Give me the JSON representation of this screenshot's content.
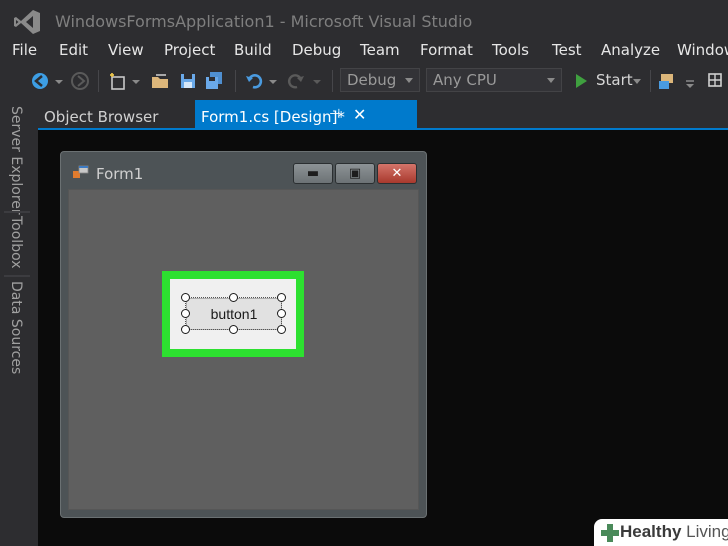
{
  "window": {
    "title": "WindowsFormsApplication1 - Microsoft Visual Studio"
  },
  "menu": [
    "File",
    "Edit",
    "View",
    "Project",
    "Build",
    "Debug",
    "Team",
    "Format",
    "Tools",
    "Test",
    "Analyze",
    "Window"
  ],
  "toolbar": {
    "config": "Debug",
    "platform": "Any CPU",
    "start_label": "Start"
  },
  "side_tabs": [
    "Server Explorer",
    "Toolbox",
    "Data Sources"
  ],
  "doc_tabs": [
    {
      "label": "Object Browser",
      "active": false
    },
    {
      "label": "Form1.cs [Design]*",
      "active": true
    }
  ],
  "tab_icons": {
    "pin": "⊣",
    "close": "✕"
  },
  "form": {
    "title": "Form1",
    "min_glyph": "▬",
    "max_glyph": "▣",
    "close_glyph": "✕",
    "button_text": "button1"
  },
  "colors": {
    "accent": "#007acc",
    "highlight": "#2de030",
    "start_green": "#3fa03f"
  },
  "watermark": {
    "bold": "Healthy",
    "light": " Living"
  }
}
